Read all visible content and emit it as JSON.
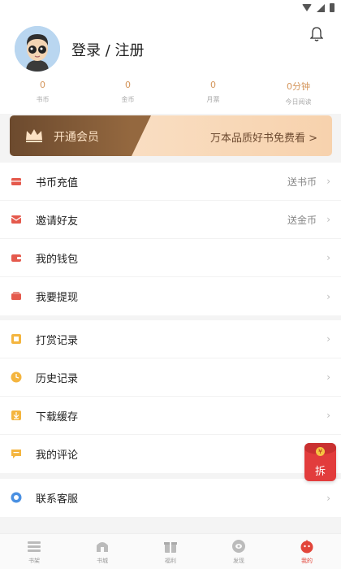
{
  "profile": {
    "login_label": "登录 / 注册"
  },
  "stats": [
    {
      "value": "0",
      "label": "书币"
    },
    {
      "value": "0",
      "label": "金币"
    },
    {
      "value": "0",
      "label": "月票"
    },
    {
      "value": "0分钟",
      "label": "今日阅读"
    }
  ],
  "vip": {
    "title": "开通会员",
    "promo": "万本品质好书免费看 >"
  },
  "menu_group1": [
    {
      "label": "书币充值",
      "value": "送书币",
      "icon": "wallet-card-icon"
    },
    {
      "label": "邀请好友",
      "value": "送金币",
      "icon": "invite-friend-icon"
    },
    {
      "label": "我的钱包",
      "value": "",
      "icon": "wallet-icon"
    },
    {
      "label": "我要提现",
      "value": "",
      "icon": "withdraw-icon"
    }
  ],
  "menu_group2": [
    {
      "label": "打赏记录",
      "value": "",
      "icon": "reward-record-icon"
    },
    {
      "label": "历史记录",
      "value": "",
      "icon": "clock-icon"
    },
    {
      "label": "下载缓存",
      "value": "",
      "icon": "download-icon"
    },
    {
      "label": "我的评论",
      "value": "",
      "icon": "comment-icon"
    }
  ],
  "menu_group3": [
    {
      "label": "联系客服",
      "value": "",
      "icon": "customer-service-icon"
    }
  ],
  "floating": {
    "label": "拆"
  },
  "tabs": [
    {
      "label": "书架",
      "icon": "bookshelf-icon"
    },
    {
      "label": "书城",
      "icon": "bookstore-icon"
    },
    {
      "label": "福利",
      "icon": "gift-icon"
    },
    {
      "label": "发现",
      "icon": "discover-icon"
    },
    {
      "label": "我的",
      "icon": "profile-icon"
    }
  ],
  "colors": {
    "accent": "#e2453a",
    "stat_number": "#d4955a",
    "vip_dark": "#6c4a2e",
    "vip_light": "#f7d2ad"
  }
}
